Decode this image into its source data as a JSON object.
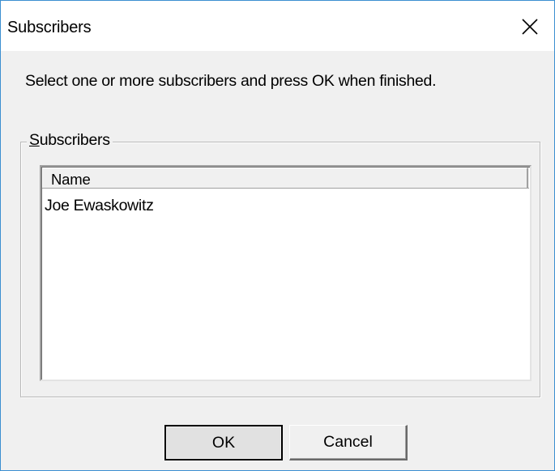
{
  "window": {
    "title": "Subscribers",
    "close_icon": "close-icon"
  },
  "instruction": "Select one or more subscribers and press OK when finished.",
  "group": {
    "label_accel": "S",
    "label_rest": "ubscribers"
  },
  "list": {
    "columns": [
      "Name"
    ],
    "rows": [
      {
        "name": "Joe Ewaskowitz"
      }
    ]
  },
  "buttons": {
    "ok_label": "OK",
    "cancel_label": "Cancel"
  },
  "colors": {
    "window_border": "#3b8fd1",
    "dialog_bg": "#f0f0f0",
    "titlebar_bg": "#ffffff"
  }
}
